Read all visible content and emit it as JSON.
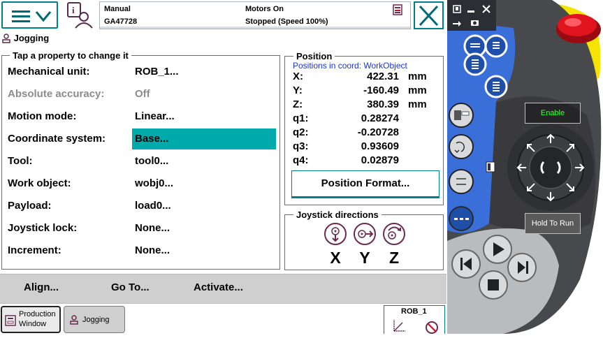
{
  "status": {
    "mode": "Manual",
    "controller": "GA47728",
    "motors": "Motors On",
    "run_state": "Stopped (Speed 100%)"
  },
  "header": {
    "title": "Jogging"
  },
  "properties": {
    "legend": "Tap a property to change it",
    "rows": [
      {
        "label": "Mechanical unit:",
        "value": "ROB_1..."
      },
      {
        "label": "Absolute accuracy:",
        "value": "Off"
      },
      {
        "label": "Motion mode:",
        "value": "Linear..."
      },
      {
        "label": "Coordinate system:",
        "value": "Base..."
      },
      {
        "label": "Tool:",
        "value": "tool0..."
      },
      {
        "label": "Work object:",
        "value": "wobj0..."
      },
      {
        "label": "Payload:",
        "value": "load0..."
      },
      {
        "label": "Joystick lock:",
        "value": "None..."
      },
      {
        "label": "Increment:",
        "value": "None..."
      }
    ],
    "selected_index": 3,
    "disabled_index": 1
  },
  "position": {
    "legend": "Position",
    "coord_text": "Positions in coord: WorkObject",
    "rows": [
      {
        "label": "X:",
        "value": "422.31",
        "unit": "mm"
      },
      {
        "label": "Y:",
        "value": "-160.49",
        "unit": "mm"
      },
      {
        "label": "Z:",
        "value": "380.39",
        "unit": "mm"
      },
      {
        "label": "q1:",
        "value": "0.28274",
        "unit": ""
      },
      {
        "label": "q2:",
        "value": "-0.20728",
        "unit": ""
      },
      {
        "label": "q3:",
        "value": "0.93609",
        "unit": ""
      },
      {
        "label": "q4:",
        "value": "0.02879",
        "unit": ""
      }
    ],
    "format_button": "Position Format..."
  },
  "joystick": {
    "legend": "Joystick directions",
    "axes": [
      "X",
      "Y",
      "Z"
    ]
  },
  "commands": {
    "align": "Align...",
    "goto": "Go To...",
    "activate": "Activate..."
  },
  "taskbar": {
    "production_line1": "Production",
    "production_line2": "Window",
    "jogging": "Jogging",
    "mech_unit": "ROB_1"
  },
  "pendant": {
    "enable": "Enable",
    "hold_to_run": "Hold To Run"
  },
  "colors": {
    "accent": "#00808a",
    "selected": "#00a9aa",
    "coord_text": "#1c35c8",
    "pendant_blue": "#3a6ed8",
    "emergency_stop": "#e0141e",
    "pendant_yellow": "#f5e400"
  }
}
